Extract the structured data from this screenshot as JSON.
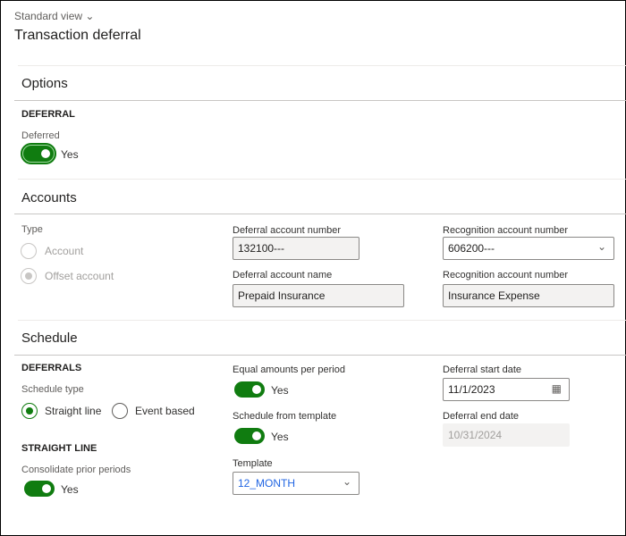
{
  "header": {
    "view": "Standard view",
    "title": "Transaction deferral"
  },
  "options": {
    "title": "Options",
    "group": "DEFERRAL",
    "deferred_label": "Deferred",
    "deferred_value": "Yes"
  },
  "accounts": {
    "title": "Accounts",
    "type_label": "Type",
    "type_options": [
      "Account",
      "Offset account"
    ],
    "deferral_number_label": "Deferral account number",
    "deferral_number": "132100---",
    "deferral_name_label": "Deferral account name",
    "deferral_name": "Prepaid Insurance",
    "recognition_number_label": "Recognition account number",
    "recognition_number": "606200---",
    "recognition_name_label": "Recognition account number",
    "recognition_name": "Insurance Expense"
  },
  "schedule": {
    "title": "Schedule",
    "group": "DEFERRALS",
    "schedule_type_label": "Schedule type",
    "schedule_types": [
      "Straight line",
      "Event based"
    ],
    "straight_group": "STRAIGHT LINE",
    "consolidate_label": "Consolidate prior periods",
    "consolidate_value": "Yes",
    "equal_label": "Equal amounts per period",
    "equal_value": "Yes",
    "from_template_label": "Schedule from template",
    "from_template_value": "Yes",
    "template_label": "Template",
    "template": "12_MONTH",
    "start_label": "Deferral start date",
    "start": "11/1/2023",
    "end_label": "Deferral end date",
    "end": "10/31/2024"
  }
}
